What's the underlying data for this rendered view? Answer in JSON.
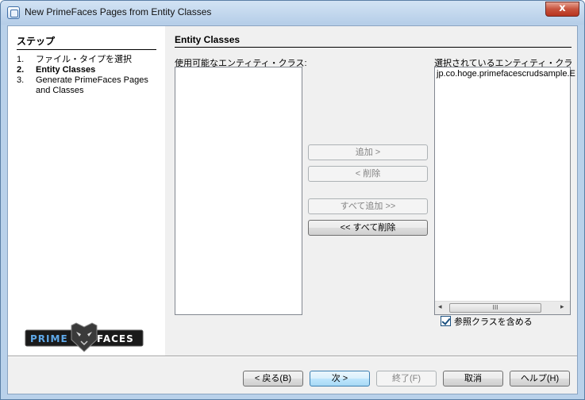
{
  "window": {
    "title": "New PrimeFaces Pages from Entity Classes",
    "close_label": "x"
  },
  "steps": {
    "heading": "ステップ",
    "items": [
      {
        "num": "1.",
        "label": "ファイル・タイプを選択"
      },
      {
        "num": "2.",
        "label": "Entity Classes"
      },
      {
        "num": "3.",
        "label": "Generate PrimeFaces Pages and Classes"
      }
    ],
    "logo_text": "PRIME FACES"
  },
  "content": {
    "section_title": "Entity Classes",
    "available_label": "使用可能なエンティティ・クラス:",
    "selected_label": "選択されているエンティティ・クラス:",
    "selected_items": [
      "jp.co.hoge.primefacescrudsample.E"
    ],
    "buttons": {
      "add": "追加 >",
      "remove": "< 削除",
      "add_all": "すべて追加 >>",
      "remove_all": "<< すべて削除"
    },
    "include_referenced": {
      "label": "参照クラスを含める",
      "checked": true
    }
  },
  "footer": {
    "back": "< 戻る(B)",
    "next": "次 >",
    "finish": "終了(F)",
    "cancel": "取消",
    "help": "ヘルプ(H)"
  }
}
